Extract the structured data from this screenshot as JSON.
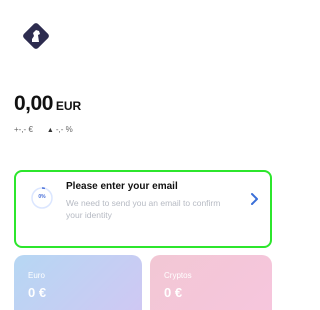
{
  "brand": {
    "logo_icon": "knight-chess-icon",
    "logo_bg": "#2d2c4f"
  },
  "balance": {
    "value": "0,00",
    "currency": "EUR"
  },
  "changes": {
    "absolute": "+-,- €",
    "percent": "-,- %"
  },
  "email_prompt": {
    "progress": "0%",
    "progress_fraction": 0,
    "title": "Please enter your email",
    "description": "We need to send you an email to confirm your identity",
    "highlight_color": "#2ce62c"
  },
  "wallets": [
    {
      "label": "Euro",
      "value": "0 €"
    },
    {
      "label": "Cryptos",
      "value": "0 €"
    }
  ]
}
